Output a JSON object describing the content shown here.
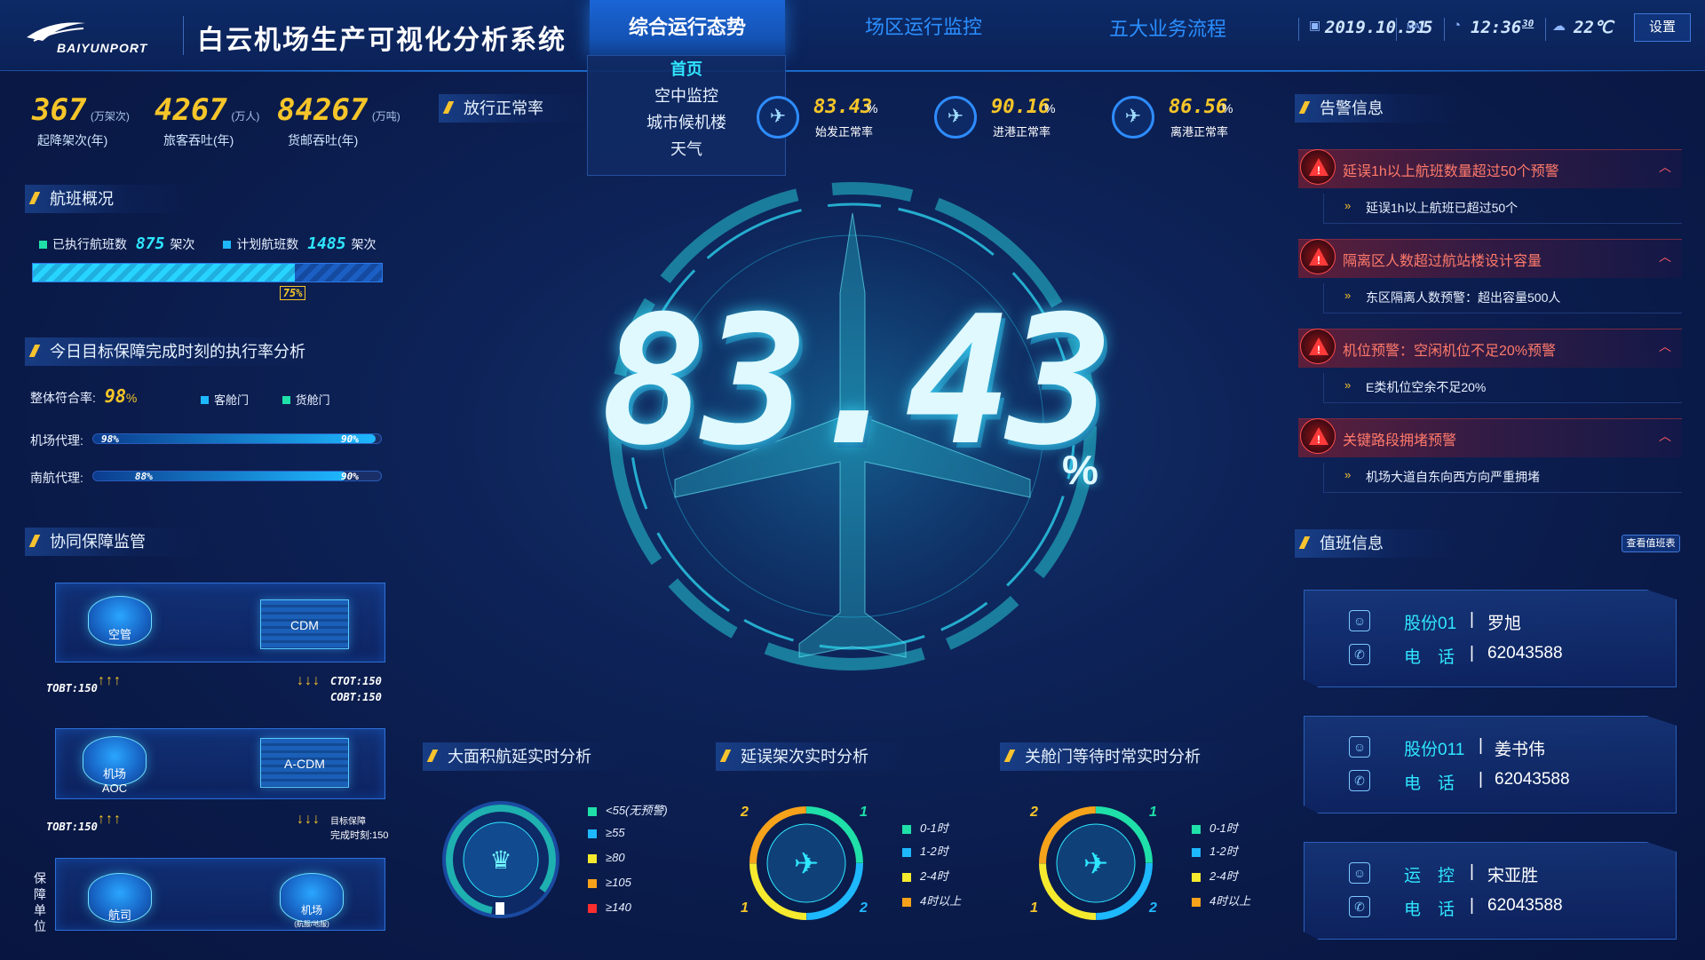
{
  "header": {
    "logo_text": "BAIYUNPORT",
    "title": "白云机场生产可视化分析系统",
    "tabs": [
      {
        "label": "综合运行态势",
        "active": true
      },
      {
        "label": "场区运行监控",
        "active": false
      },
      {
        "label": "五大业务流程",
        "active": false
      }
    ],
    "date": "2019.10.31",
    "week_label": "MAI",
    "week_value": "5",
    "time": "12:36",
    "seconds": "30",
    "temperature": "22℃",
    "settings_label": "设置"
  },
  "dropdown": {
    "items": [
      {
        "label": "首页",
        "selected": true
      },
      {
        "label": "空中监控",
        "selected": false
      },
      {
        "label": "城市候机楼",
        "selected": false
      },
      {
        "label": "天气",
        "selected": false
      }
    ]
  },
  "stats": [
    {
      "value": "367",
      "unit": "(万架次)",
      "label": "起降架次(年)"
    },
    {
      "value": "4267",
      "unit": "(万人)",
      "label": "旅客吞吐(年)"
    },
    {
      "value": "84267",
      "unit": "(万吨)",
      "label": "货邮吞吐(年)"
    }
  ],
  "release": {
    "title": "放行正常率",
    "items": [
      {
        "value": "83.43",
        "pct": "%",
        "label": "始发正常率"
      },
      {
        "value": "90.16",
        "pct": "%",
        "label": "进港正常率"
      },
      {
        "value": "86.56",
        "pct": "%",
        "label": "离港正常率"
      }
    ]
  },
  "flights": {
    "title": "航班概况",
    "executed_label": "已执行航班数",
    "executed_value": "875",
    "executed_unit": "架次",
    "planned_label": "计划航班数",
    "planned_value": "1485",
    "planned_unit": "架次",
    "progress_label": "75%",
    "progress": 0.75
  },
  "target": {
    "title": "今日目标保障完成时刻的执行率分析",
    "overall_label": "整体符合率:",
    "overall_value": "98",
    "overall_pct": "%",
    "legend_cabin": "客舱门",
    "legend_cargo": "货舱门",
    "rows": [
      {
        "label": "机场代理:",
        "cabin": "98%",
        "cargo": "90%",
        "cabin_val": 0.98,
        "cargo_val": 0.9
      },
      {
        "label": "南航代理:",
        "cabin": "88%",
        "cargo": "90%",
        "cabin_val": 0.88,
        "cargo_val": 0.9
      }
    ]
  },
  "coop": {
    "title": "协同保障监管",
    "atc": "空管",
    "cdm": "CDM",
    "aoc_line1": "机场",
    "aoc_line2": "AOC",
    "acdm": "A-CDM",
    "tobt1": "TOBT:150",
    "ctot": "CTOT:150",
    "cobt": "COBT:150",
    "tobt2": "TOBT:150",
    "target_line1": "目标保障",
    "target_line2": "完成时刻:150",
    "unit_label": "保障单位",
    "airline": "航司",
    "airport_line1": "机场",
    "airport_line2": "(航服/地服)"
  },
  "center": {
    "value": "83.43",
    "pct": "%"
  },
  "delay_analysis": {
    "title": "大面积航延实时分析",
    "legend": [
      {
        "label": "<55(无预警)",
        "color": "#1fe0a8"
      },
      {
        "label": "≥55",
        "color": "#1eb8ff"
      },
      {
        "label": "≥80",
        "color": "#f5ea2e"
      },
      {
        "label": "≥105",
        "color": "#f7a21b"
      },
      {
        "label": "≥140",
        "color": "#ff2e2e"
      }
    ]
  },
  "delayed_flights": {
    "title": "延误架次实时分析",
    "ring_labels": [
      "2",
      "1",
      "1",
      "2"
    ],
    "legend": [
      {
        "label": "0-1时",
        "color": "#1fe0a8"
      },
      {
        "label": "1-2时",
        "color": "#1eb8ff"
      },
      {
        "label": "2-4时",
        "color": "#f5ea2e"
      },
      {
        "label": "4时以上",
        "color": "#f7a21b"
      }
    ]
  },
  "door_wait": {
    "title": "关舱门等待时常实时分析",
    "ring_labels": [
      "2",
      "1",
      "1",
      "2"
    ],
    "legend": [
      {
        "label": "0-1时",
        "color": "#1fe0a8"
      },
      {
        "label": "1-2时",
        "color": "#1eb8ff"
      },
      {
        "label": "2-4时",
        "color": "#f5ea2e"
      },
      {
        "label": "4时以上",
        "color": "#f7a21b"
      }
    ]
  },
  "alerts": {
    "title": "告警信息",
    "items": [
      {
        "title": "延误1h以上航班数量超过50个预警",
        "desc": "延误1h以上航班已超过50个"
      },
      {
        "title": "隔离区人数超过航站楼设计容量",
        "desc": "东区隔离人数预警：超出容量500人"
      },
      {
        "title": "机位预警：空闲机位不足20%预警",
        "desc": "E类机位空余不足20%"
      },
      {
        "title": "关键路段拥堵预警",
        "desc": "机场大道自东向西方向严重拥堵"
      }
    ]
  },
  "duty": {
    "title": "值班信息",
    "schedule_button": "查看值班表",
    "phone_label": "电　话",
    "sep": "|",
    "cards": [
      {
        "role": "股份01",
        "name": "罗旭",
        "phone": "62043588"
      },
      {
        "role": "股份011",
        "name": "姜书伟",
        "phone": "62043588"
      },
      {
        "role": "运　控",
        "name": "宋亚胜",
        "phone": "62043588"
      }
    ]
  },
  "colors": {
    "accent_blue": "#1f8cff",
    "digit_yellow": "#f6c529",
    "digit_cyan": "#2fe6ff",
    "alert_red": "#ff5a5a"
  }
}
